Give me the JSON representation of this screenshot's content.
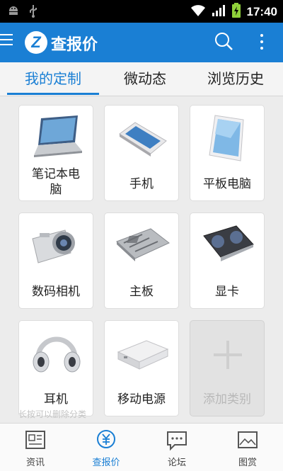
{
  "status_bar": {
    "time": "17:40"
  },
  "app_bar": {
    "logo_letter": "Z",
    "title": "查报价"
  },
  "tabs": [
    {
      "label": "我的定制",
      "selected": true
    },
    {
      "label": "微动态",
      "selected": false
    },
    {
      "label": "浏览历史",
      "selected": false
    }
  ],
  "categories": [
    {
      "label": "笔记本电脑"
    },
    {
      "label": "手机"
    },
    {
      "label": "平板电脑"
    },
    {
      "label": "数码相机"
    },
    {
      "label": "主板"
    },
    {
      "label": "显卡"
    },
    {
      "label": "耳机"
    },
    {
      "label": "移动电源"
    },
    {
      "label": "添加类别"
    }
  ],
  "hint": "长按可以删除分类",
  "bottom_nav": [
    {
      "label": "资讯",
      "icon": "news-icon"
    },
    {
      "label": "查报价",
      "icon": "price-icon",
      "active": true
    },
    {
      "label": "论坛",
      "icon": "forum-icon"
    },
    {
      "label": "图赏",
      "icon": "gallery-icon"
    }
  ],
  "colors": {
    "primary": "#1a7fd4",
    "status_bar": "#000000"
  }
}
